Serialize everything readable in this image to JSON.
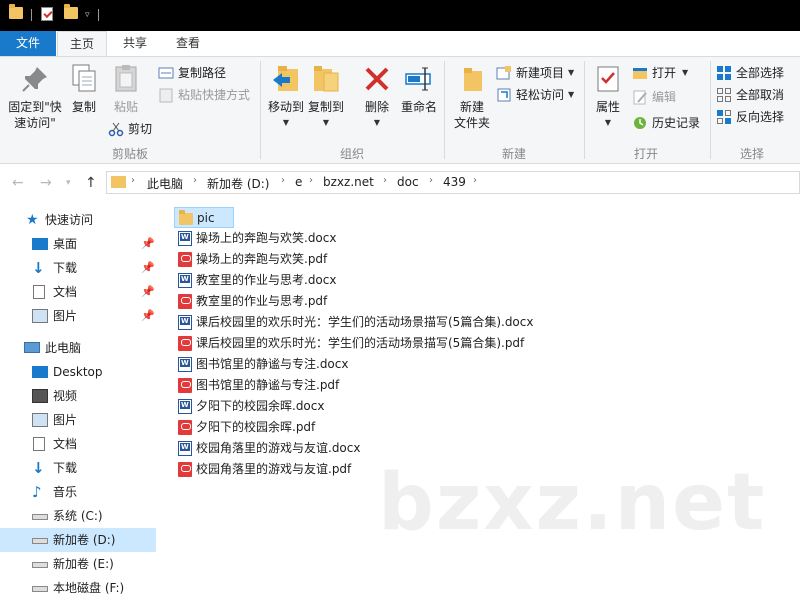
{
  "tabs": {
    "file": "文件",
    "home": "主页",
    "share": "共享",
    "view": "查看"
  },
  "ribbon": {
    "clipboard": {
      "label": "剪贴板",
      "pin": "固定到\"快\n速访问\"",
      "pin_line1": "固定到\"快",
      "pin_line2": "速访问\"",
      "copy": "复制",
      "paste": "粘贴",
      "copy_path": "复制路径",
      "paste_shortcut": "粘贴快捷方式",
      "cut": "剪切"
    },
    "organize": {
      "label": "组织",
      "move_to": "移动到",
      "copy_to": "复制到",
      "delete": "删除",
      "rename": "重命名"
    },
    "new": {
      "label": "新建",
      "new_folder_line1": "新建",
      "new_folder_line2": "文件夹",
      "new_item": "新建项目",
      "easy_access": "轻松访问"
    },
    "open": {
      "label": "打开",
      "properties": "属性",
      "open": "打开",
      "edit": "编辑",
      "history": "历史记录"
    },
    "select": {
      "label": "选择",
      "select_all": "全部选择",
      "select_none": "全部取消",
      "invert": "反向选择"
    }
  },
  "address": {
    "crumbs": [
      "此电脑",
      "新加卷 (D:)",
      "e",
      "bzxz.net",
      "doc",
      "439"
    ]
  },
  "nav": {
    "quick_access": "快速访问",
    "qa_items": [
      "桌面",
      "下载",
      "文档",
      "图片"
    ],
    "this_pc": "此电脑",
    "pc_items": [
      "Desktop",
      "视频",
      "图片",
      "文档",
      "下载",
      "音乐",
      "系统 (C:)",
      "新加卷 (D:)",
      "新加卷 (E:)",
      "本地磁盘 (F:)"
    ]
  },
  "files": [
    {
      "name": "pic",
      "type": "folder"
    },
    {
      "name": "操场上的奔跑与欢笑.docx",
      "type": "docx"
    },
    {
      "name": "操场上的奔跑与欢笑.pdf",
      "type": "pdf"
    },
    {
      "name": "教室里的作业与思考.docx",
      "type": "docx"
    },
    {
      "name": "教室里的作业与思考.pdf",
      "type": "pdf"
    },
    {
      "name": "课后校园里的欢乐时光：学生们的活动场景描写(5篇合集).docx",
      "type": "docx"
    },
    {
      "name": "课后校园里的欢乐时光：学生们的活动场景描写(5篇合集).pdf",
      "type": "pdf"
    },
    {
      "name": "图书馆里的静谧与专注.docx",
      "type": "docx"
    },
    {
      "name": "图书馆里的静谧与专注.pdf",
      "type": "pdf"
    },
    {
      "name": "夕阳下的校园余晖.docx",
      "type": "docx"
    },
    {
      "name": "夕阳下的校园余晖.pdf",
      "type": "pdf"
    },
    {
      "name": "校园角落里的游戏与友谊.docx",
      "type": "docx"
    },
    {
      "name": "校园角落里的游戏与友谊.pdf",
      "type": "pdf"
    }
  ],
  "watermark": "bzxz.net",
  "colors": {
    "accent": "#1979ca",
    "selection": "#cce8ff",
    "titlebar": "#000000"
  }
}
